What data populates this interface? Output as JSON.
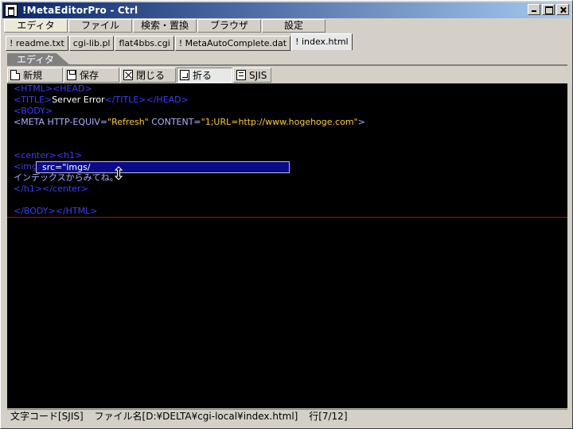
{
  "window": {
    "title": "!MetaEditorPro - Ctrl"
  },
  "menu": {
    "items": [
      "エディタ",
      "ファイル",
      "検索・置換",
      "ブラウザ",
      "設定"
    ]
  },
  "file_tabs": [
    "! readme.txt",
    "cgi-lib.pl",
    "flat4bbs.cgi",
    "! MetaAutoComplete.dat",
    "! index.html"
  ],
  "editor_tab": "エディタ",
  "toolbar": {
    "new": "新規",
    "save": "保存",
    "close": "閉じる",
    "wrap": "折る",
    "encoding": "SJIS"
  },
  "code": {
    "l1": {
      "a": "<HTML>",
      "b": "<HEAD>"
    },
    "l2": {
      "a": "<TITLE>",
      "b": "Server Error",
      "c": "</TITLE>",
      "d": "</HEAD>"
    },
    "l3": {
      "a": "<BODY>"
    },
    "l4": {
      "a": "<META HTTP-EQUIV=",
      "b": "\"Refresh\"",
      "c": " CONTENT=",
      "d": "\"1;URL=http://www.hogehoge.com\"",
      "e": ">"
    },
    "l7": {
      "a": "<center>",
      "b": "<h1>"
    },
    "l8": {
      "a": "<img"
    },
    "l9": {
      "a": "インデックスからみてね。"
    },
    "l10": {
      "a": "</h1>",
      "b": "</center>"
    },
    "l12": {
      "a": "</BODY>",
      "b": "</HTML>"
    }
  },
  "autocomplete": {
    "text": "src=\"imgs/"
  },
  "status": {
    "encoding": "文字コード[SJIS]",
    "filename": "ファイル名[D:¥DELTA¥cgi-local¥index.html]",
    "line": "行[7/12]"
  },
  "colors": {
    "tag": "#3c3cff",
    "text": "#ffffff",
    "string": "#ffcc33",
    "editor_bg": "#000000",
    "title_bar": "#0a246a",
    "eof_marker": "#d00000"
  }
}
